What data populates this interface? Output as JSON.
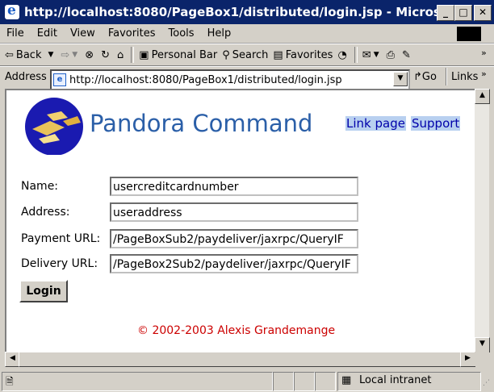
{
  "window": {
    "title": "http://localhost:8080/PageBox1/distributed/login.jsp - Microsoft Inte...",
    "minimize": "_",
    "maximize": "□",
    "close": "✕"
  },
  "menu": {
    "items": [
      "File",
      "Edit",
      "View",
      "Favorites",
      "Tools",
      "Help"
    ]
  },
  "toolbar": {
    "back_label": "Back",
    "personal_bar_label": "Personal Bar",
    "search_label": "Search",
    "favorites_label": "Favorites"
  },
  "address": {
    "label": "Address",
    "url": "http://localhost:8080/PageBox1/distributed/login.jsp",
    "go_label": "Go",
    "links_label": "Links"
  },
  "page": {
    "brand": "Pandora Command",
    "links": [
      "Link page",
      "Support"
    ],
    "form": {
      "name_label": "Name:",
      "name_value": "usercreditcardnumber",
      "address_label": "Address:",
      "address_value": "useraddress",
      "payment_label": "Payment URL:",
      "payment_value": "/PageBoxSub2/paydeliver/jaxrpc/QueryIF",
      "delivery_label": "Delivery URL:",
      "delivery_value": "/PageBox2Sub2/paydeliver/jaxrpc/QueryIF",
      "login_label": "Login"
    },
    "copyright": "© 2002-2003 Alexis Grandemange"
  },
  "status": {
    "zone": "Local intranet"
  }
}
